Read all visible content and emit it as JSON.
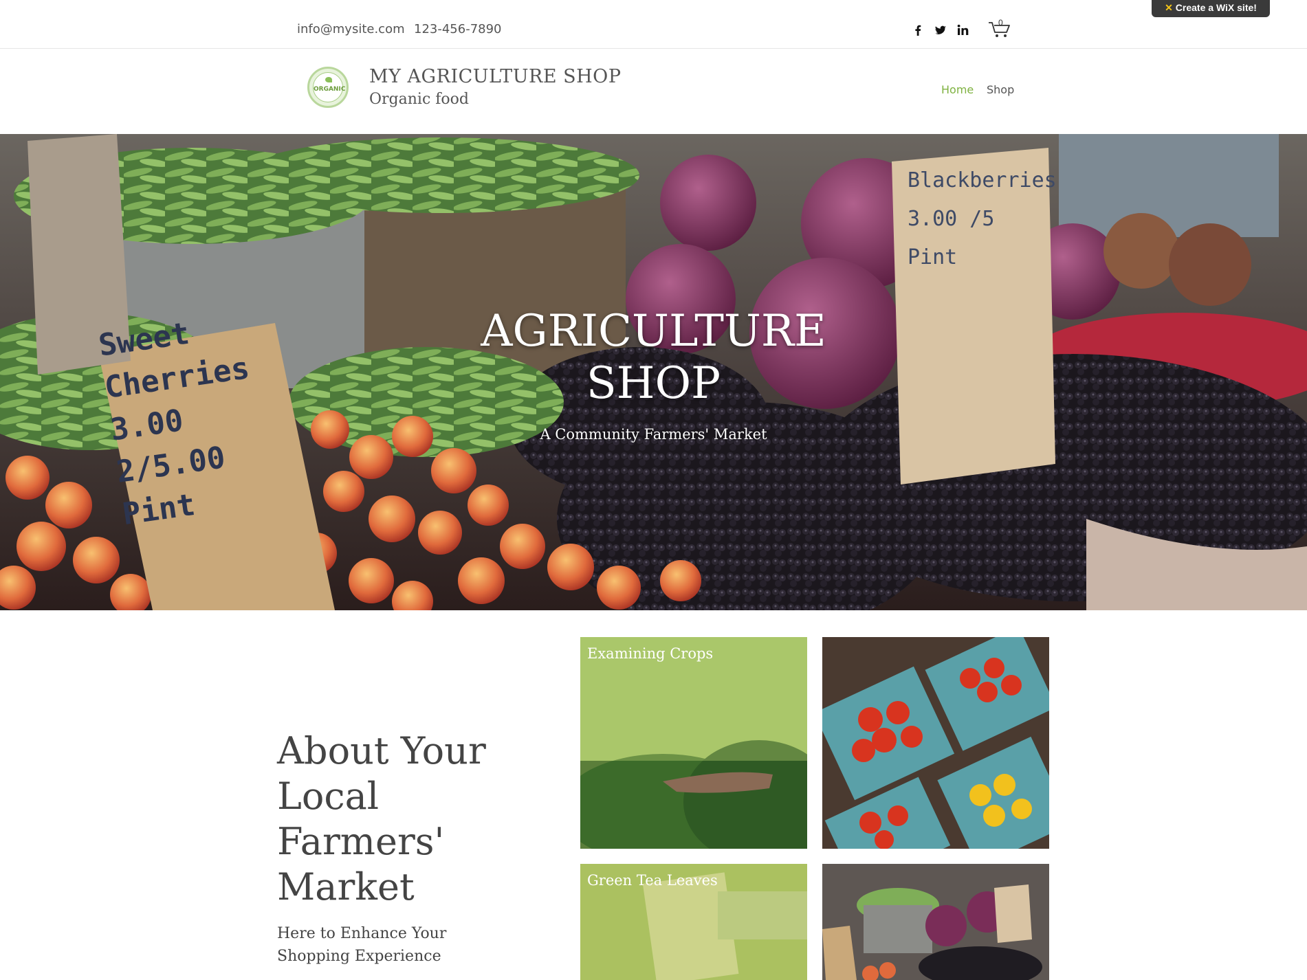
{
  "header": {
    "email": "info@mysite.com",
    "phone": "123-456-7890",
    "social": [
      {
        "name": "facebook",
        "glyph": "f"
      },
      {
        "name": "twitter",
        "glyph": "🐦"
      },
      {
        "name": "linkedin",
        "glyph": "in"
      }
    ],
    "cart_count": "0",
    "wix_badge": "Create a WiX site!"
  },
  "site": {
    "logo_text": "ORGANIC",
    "title": "MY AGRICULTURE SHOP",
    "subtitle": "Organic food"
  },
  "nav": {
    "items": [
      {
        "label": "Home",
        "active": true
      },
      {
        "label": "Shop",
        "active": false
      }
    ]
  },
  "hero": {
    "title_line1": "AGRICULTURE",
    "title_line2": "SHOP",
    "subtitle": "A Community Farmers' Market",
    "sign_left": "Sweet Cherries 3.00 2/5.00 Pint",
    "sign_right": "Blackberries 3.00 /5 Pint"
  },
  "about": {
    "heading": "About Your Local Farmers' Market",
    "text": "Here to Enhance Your Shopping Experience"
  },
  "gallery": {
    "tiles": [
      {
        "caption": "Examining Crops"
      },
      {
        "caption": ""
      },
      {
        "caption": "Green Tea Leaves"
      },
      {
        "caption": ""
      }
    ]
  },
  "colors": {
    "accent": "#7fb241",
    "text": "#555555",
    "badge_bg": "#3a3a3a"
  }
}
